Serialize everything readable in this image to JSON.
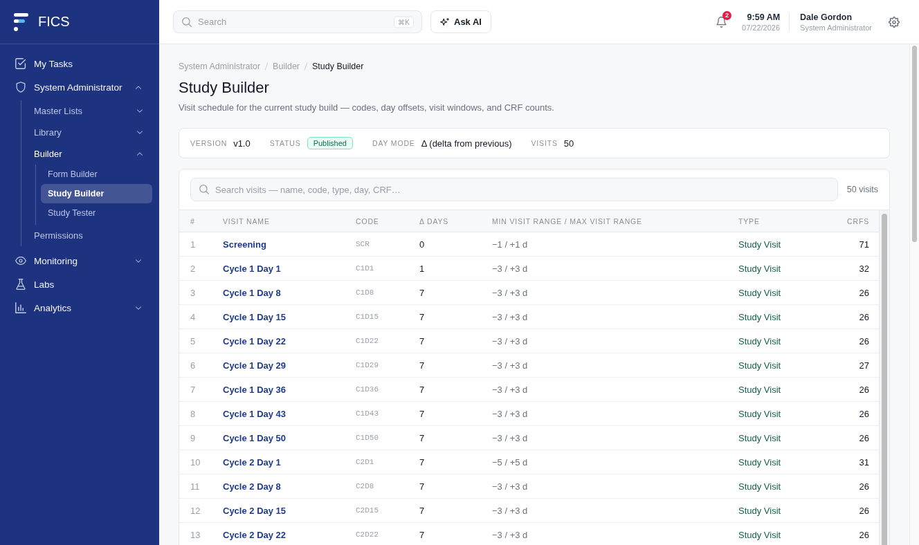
{
  "sidebar": {
    "brand": "FICS",
    "items": [
      {
        "label": "My Tasks",
        "selected": false
      },
      {
        "label": "System Administrator",
        "selected": false,
        "expanded": true,
        "children": [
          {
            "label": "Master Lists",
            "selected": false,
            "expanded": false
          },
          {
            "label": "Library",
            "selected": false,
            "expanded": false
          },
          {
            "label": "Builder",
            "selected": false,
            "expanded": true,
            "children": [
              {
                "label": "Form Builder",
                "selected": false
              },
              {
                "label": "Study Builder",
                "selected": true
              },
              {
                "label": "Study Tester",
                "selected": false
              }
            ]
          },
          {
            "label": "Permissions",
            "selected": false
          }
        ]
      },
      {
        "label": "Monitoring",
        "selected": false,
        "expanded": false
      },
      {
        "label": "Labs",
        "selected": false
      },
      {
        "label": "Analytics",
        "selected": false,
        "expanded": false
      }
    ]
  },
  "topbar": {
    "search": {
      "placeholder": "Search",
      "shortcut": "⌘K"
    },
    "ask_ai": "Ask AI",
    "notifications": "2",
    "time": "9:59 AM",
    "date": "07/22/2026",
    "user": {
      "name": "Dale Gordon",
      "role": "System Administrator"
    }
  },
  "breadcrumb": [
    {
      "label": "System Administrator",
      "current": false
    },
    {
      "label": "Builder",
      "current": false
    },
    {
      "label": "Study Builder",
      "current": true
    }
  ],
  "page": {
    "title": "Study Builder",
    "description": "Visit schedule for the current study build — codes, day offsets, visit windows, and CRF counts."
  },
  "summary": [
    {
      "kind": "text",
      "label": "VERSION",
      "value": "v1.0"
    },
    {
      "kind": "badge",
      "label": "STATUS",
      "value": "Published"
    },
    {
      "kind": "text",
      "label": "DAY MODE",
      "value": "Δ (delta from previous)"
    },
    {
      "kind": "text",
      "label": "VISITS",
      "value": "50"
    }
  ],
  "visits": {
    "search": {
      "placeholder": "Search visits — name, code, type, day, CRF…"
    },
    "count": "50 visits",
    "columns": [
      "#",
      "VISIT NAME",
      "CODE",
      "Δ DAYS",
      "MIN VISIT RANGE / MAX VISIT RANGE",
      "TYPE",
      "CRFS"
    ],
    "rows": [
      {
        "number": "1",
        "name": "Screening",
        "code": "SCR",
        "days": "0",
        "range": "−1 / +1 d",
        "type": "Study Visit",
        "crfs": "71"
      },
      {
        "number": "2",
        "name": "Cycle 1 Day 1",
        "code": "C1D1",
        "days": "1",
        "range": "−3 / +3 d",
        "type": "Study Visit",
        "crfs": "32"
      },
      {
        "number": "3",
        "name": "Cycle 1 Day 8",
        "code": "C1D8",
        "days": "7",
        "range": "−3 / +3 d",
        "type": "Study Visit",
        "crfs": "26"
      },
      {
        "number": "4",
        "name": "Cycle 1 Day 15",
        "code": "C1D15",
        "days": "7",
        "range": "−3 / +3 d",
        "type": "Study Visit",
        "crfs": "26"
      },
      {
        "number": "5",
        "name": "Cycle 1 Day 22",
        "code": "C1D22",
        "days": "7",
        "range": "−3 / +3 d",
        "type": "Study Visit",
        "crfs": "26"
      },
      {
        "number": "6",
        "name": "Cycle 1 Day 29",
        "code": "C1D29",
        "days": "7",
        "range": "−3 / +3 d",
        "type": "Study Visit",
        "crfs": "27"
      },
      {
        "number": "7",
        "name": "Cycle 1 Day 36",
        "code": "C1D36",
        "days": "7",
        "range": "−3 / +3 d",
        "type": "Study Visit",
        "crfs": "26"
      },
      {
        "number": "8",
        "name": "Cycle 1 Day 43",
        "code": "C1D43",
        "days": "7",
        "range": "−3 / +3 d",
        "type": "Study Visit",
        "crfs": "26"
      },
      {
        "number": "9",
        "name": "Cycle 1 Day 50",
        "code": "C1D50",
        "days": "7",
        "range": "−3 / +3 d",
        "type": "Study Visit",
        "crfs": "26"
      },
      {
        "number": "10",
        "name": "Cycle 2 Day 1",
        "code": "C2D1",
        "days": "7",
        "range": "−5 / +5 d",
        "type": "Study Visit",
        "crfs": "31"
      },
      {
        "number": "11",
        "name": "Cycle 2 Day 8",
        "code": "C2D8",
        "days": "7",
        "range": "−3 / +3 d",
        "type": "Study Visit",
        "crfs": "26"
      },
      {
        "number": "12",
        "name": "Cycle 2 Day 15",
        "code": "C2D15",
        "days": "7",
        "range": "−3 / +3 d",
        "type": "Study Visit",
        "crfs": "26"
      },
      {
        "number": "13",
        "name": "Cycle 2 Day 22",
        "code": "C2D22",
        "days": "7",
        "range": "−3 / +3 d",
        "type": "Study Visit",
        "crfs": "26"
      }
    ]
  }
}
